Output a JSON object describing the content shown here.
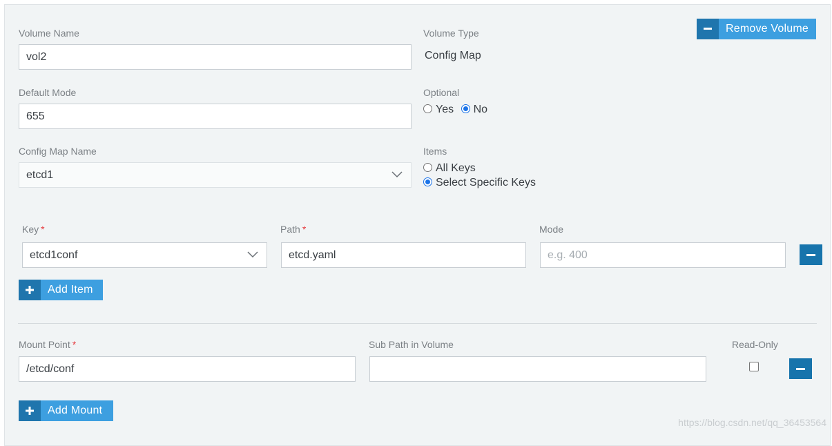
{
  "volume": {
    "name_label": "Volume Name",
    "name_value": "vol2",
    "type_label": "Volume Type",
    "type_value": "Config Map",
    "remove_label": "Remove Volume",
    "default_mode_label": "Default Mode",
    "default_mode_value": "655",
    "optional_label": "Optional",
    "optional_yes": "Yes",
    "optional_no": "No",
    "optional_selected": "No",
    "config_map_label": "Config Map Name",
    "config_map_value": "etcd1",
    "items_label": "Items",
    "items_all": "All Keys",
    "items_specific": "Select Specific Keys",
    "items_selected": "Select Specific Keys"
  },
  "items": {
    "key_label": "Key",
    "path_label": "Path",
    "mode_label": "Mode",
    "required_mark": "*",
    "rows": [
      {
        "key": "etcd1conf",
        "path": "etcd.yaml",
        "mode": "",
        "mode_placeholder": "e.g. 400"
      }
    ],
    "add_label": "Add Item"
  },
  "mount": {
    "point_label": "Mount Point",
    "point_value": "/etcd/conf",
    "subpath_label": "Sub Path in Volume",
    "subpath_value": "",
    "readonly_label": "Read-Only",
    "readonly_checked": false,
    "add_label": "Add Mount"
  },
  "watermark": "https://blog.csdn.net/qq_36453564",
  "colors": {
    "accent": "#3d9fe0",
    "accent_dark": "#1f75ad",
    "panel_bg": "#f1f4f5",
    "required": "#e5393d"
  }
}
